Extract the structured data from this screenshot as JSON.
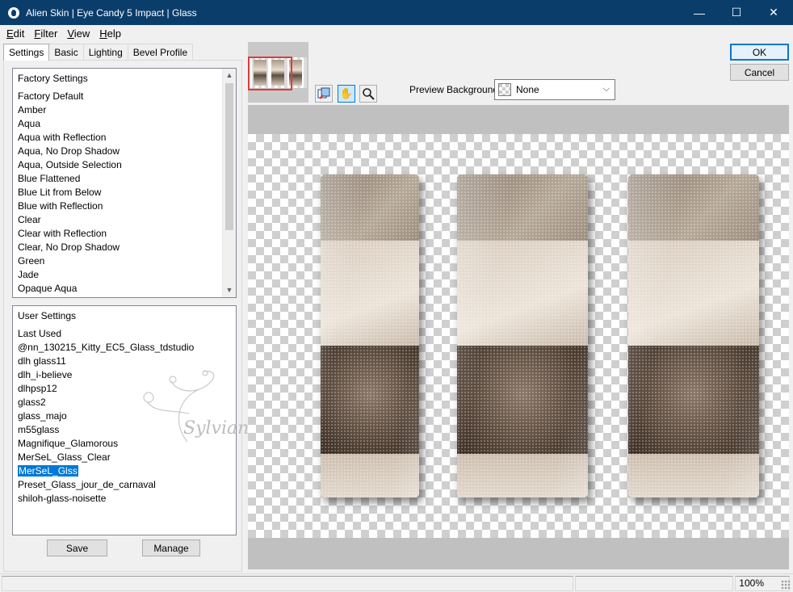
{
  "window": {
    "title": "Alien Skin | Eye Candy 5 Impact | Glass",
    "minimize_glyph": "—",
    "maximize_glyph": "☐",
    "close_glyph": "✕"
  },
  "menu": [
    {
      "accel": "E",
      "rest": "dit"
    },
    {
      "accel": "F",
      "rest": "ilter"
    },
    {
      "accel": "V",
      "rest": "iew"
    },
    {
      "accel": "H",
      "rest": "elp"
    }
  ],
  "tabs": [
    "Settings",
    "Basic",
    "Lighting",
    "Bevel Profile"
  ],
  "factory_settings": {
    "header": "Factory Settings",
    "items": [
      "Factory Default",
      "Amber",
      "Aqua",
      "Aqua with Reflection",
      "Aqua, No Drop Shadow",
      "Aqua, Outside Selection",
      "Blue Flattened",
      "Blue Lit from Below",
      "Blue with Reflection",
      "Clear",
      "Clear with Reflection",
      "Clear, No Drop Shadow",
      "Green",
      "Jade",
      "Opaque Aqua"
    ]
  },
  "user_settings": {
    "header": "User Settings",
    "items": [
      "Last Used",
      "@nn_130215_Kitty_EC5_Glass_tdstudio",
      "dlh glass11",
      "dlh_i-believe",
      "dlhpsp12",
      "glass2",
      "glass_majo",
      "m55glass",
      "Magnifique_Glamorous",
      "MerSeL_Glass_Clear",
      "MerSeL_Glss",
      "Preset_Glass_jour_de_carnaval",
      "shiloh-glass-noisette"
    ],
    "selected": "MerSeL_Glss"
  },
  "buttons": {
    "save": "Save",
    "manage": "Manage",
    "ok": "OK",
    "cancel": "Cancel"
  },
  "preview": {
    "background_label": "Preview Background:",
    "background_value": "None",
    "tools": [
      "preview-toggle-icon",
      "hand-icon",
      "zoom-icon"
    ]
  },
  "watermark": "Sylviane",
  "status": {
    "zoom": "100%"
  }
}
